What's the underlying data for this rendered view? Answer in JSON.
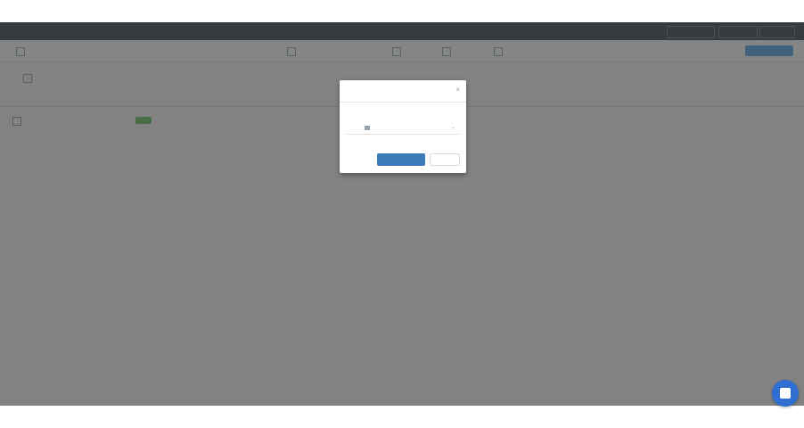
{
  "app": {
    "logo": "",
    "breadcrumb": ""
  },
  "topbar": {
    "right_buttons": [
      "",
      "",
      ""
    ]
  },
  "toolbar": {
    "primary_button": ""
  },
  "subbar": {
    "filter_text": "",
    "center_text": "",
    "right_text": ""
  },
  "table": {
    "headers": [
      "",
      "",
      "",
      "",
      "",
      ""
    ],
    "rows": [
      [
        "",
        "",
        "",
        "",
        ""
      ]
    ]
  },
  "dialog": {
    "title": "",
    "close_glyph": "×",
    "field_label": "",
    "select_value": "",
    "primary_button": "",
    "cancel_button": ""
  },
  "colors": {
    "topbar": "#2e3a47",
    "overlay": "rgba(60,60,60,0.62)",
    "dialog_primary": "#3d7ab8",
    "chat": "#2f6fd1",
    "tag": "#5cb85c"
  },
  "icons": {
    "chat": "chat-bubble-icon",
    "dialog_close": "close-icon",
    "select_chevron": "chevron-down-icon"
  }
}
